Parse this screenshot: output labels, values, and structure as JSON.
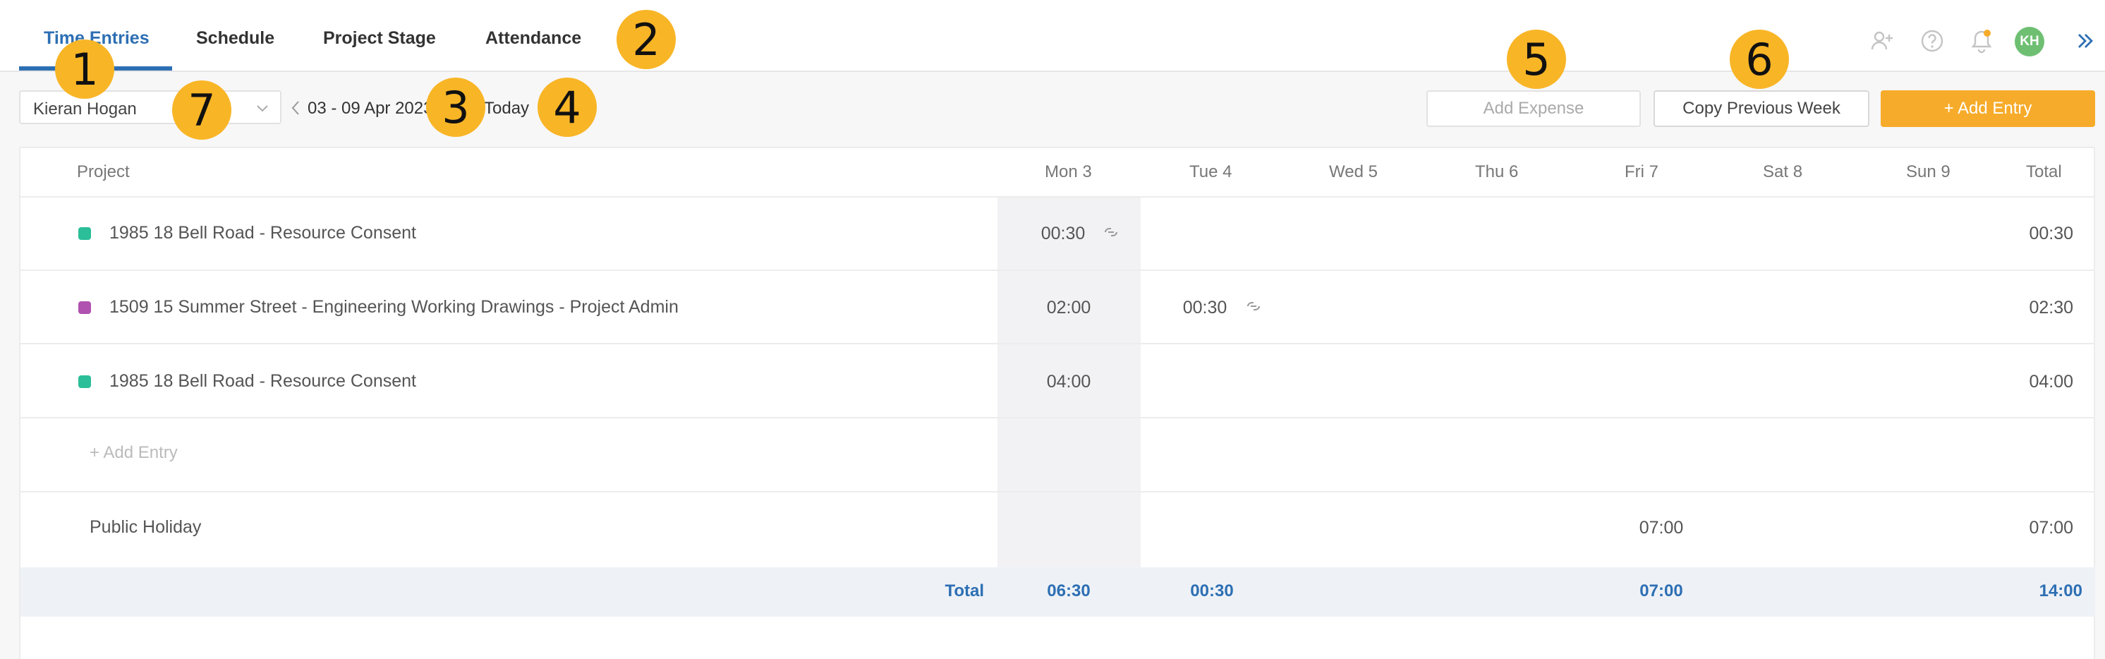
{
  "tabs": [
    {
      "label": "Time Entries",
      "active": true
    },
    {
      "label": "Schedule"
    },
    {
      "label": "Project Stage"
    },
    {
      "label": "Attendance"
    }
  ],
  "header_icons": [
    "add-user-icon",
    "help-icon",
    "bell-icon",
    "chevrons-right-icon"
  ],
  "user": {
    "initials": "KH"
  },
  "toolbar": {
    "selected_user": "Kieran Hogan",
    "date_range": "03 - 09 Apr 2023",
    "today_label": "Today",
    "add_expense_label": "Add Expense",
    "copy_previous_week_label": "Copy Previous Week",
    "add_entry_label": "+ Add Entry"
  },
  "table": {
    "headers": [
      "Project",
      "Mon 3",
      "Tue 4",
      "Wed 5",
      "Thu 6",
      "Fri 7",
      "Sat 8",
      "Sun 9",
      "Total"
    ],
    "rows": [
      {
        "color": "#2bbf99",
        "project": "1985 18 Bell Road - Resource Consent",
        "mon": "00:30",
        "tue": "",
        "fri": "",
        "total": "00:30"
      },
      {
        "color": "#b052b0",
        "project": "1509 15 Summer Street - Engineering Working Drawings - Project Admin",
        "mon": "02:00",
        "tue": "00:30",
        "fri": "",
        "total": "02:30"
      },
      {
        "color": "#2bbf99",
        "project": "1985 18 Bell Road - Resource Consent",
        "mon": "04:00",
        "tue": "",
        "fri": "",
        "total": "04:00"
      }
    ],
    "add_entry_label": "+ Add Entry",
    "public_holiday": {
      "label": "Public Holiday",
      "fri": "07:00",
      "total": "07:00"
    },
    "totals": {
      "label": "Total",
      "mon": "06:30",
      "tue": "00:30",
      "fri": "07:00",
      "total": "14:00"
    }
  },
  "colors": {
    "accent": "#2d6fb3",
    "primary_button": "#f7ab2a",
    "callout": "#f8b526",
    "avatar": "#6fbf73"
  },
  "callouts": [
    "1",
    "2",
    "3",
    "4",
    "5",
    "6",
    "7"
  ]
}
